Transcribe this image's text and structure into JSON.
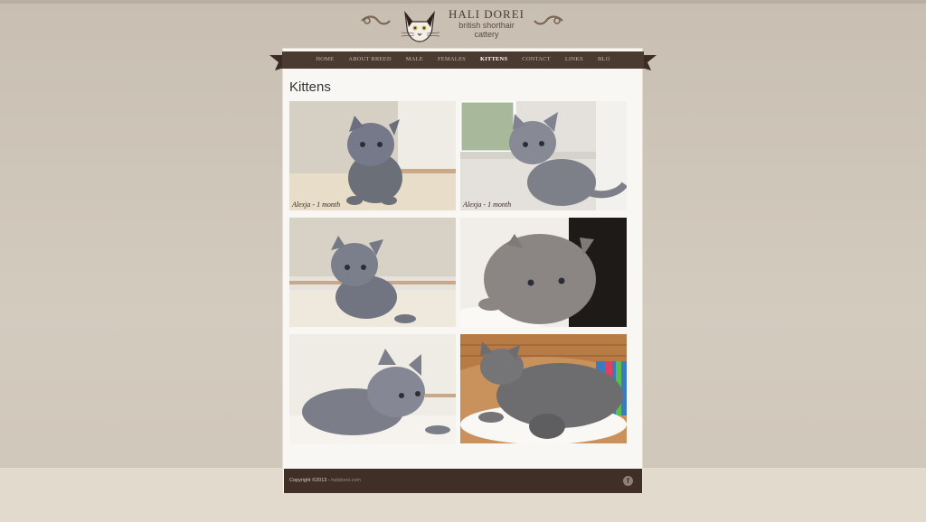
{
  "brand": {
    "name": "HALI DOREI",
    "subtitle_line1": "british shorthair",
    "subtitle_line2": "cattery"
  },
  "nav": {
    "items": [
      {
        "label": "HOME"
      },
      {
        "label": "ABOUT BREED"
      },
      {
        "label": "MALE"
      },
      {
        "label": "FEMALES"
      },
      {
        "label": "KITTENS"
      },
      {
        "label": "CONTACT"
      },
      {
        "label": "LINKS"
      },
      {
        "label": "BLO"
      }
    ],
    "active": "KITTENS"
  },
  "page_title": "Kittens",
  "photos": [
    {
      "caption": "Alexja - 1 month"
    },
    {
      "caption": "Alexja - 1 month"
    },
    {
      "caption": ""
    },
    {
      "caption": ""
    },
    {
      "caption": ""
    },
    {
      "caption": ""
    }
  ],
  "footer": {
    "copyright": "Copyright ©2013 - ",
    "site_link": "halidorei.com",
    "facebook_icon": "f"
  },
  "colors": {
    "ribbon": "#4a3a30",
    "footer": "#3f2f27",
    "background": "#cdc4b7"
  }
}
